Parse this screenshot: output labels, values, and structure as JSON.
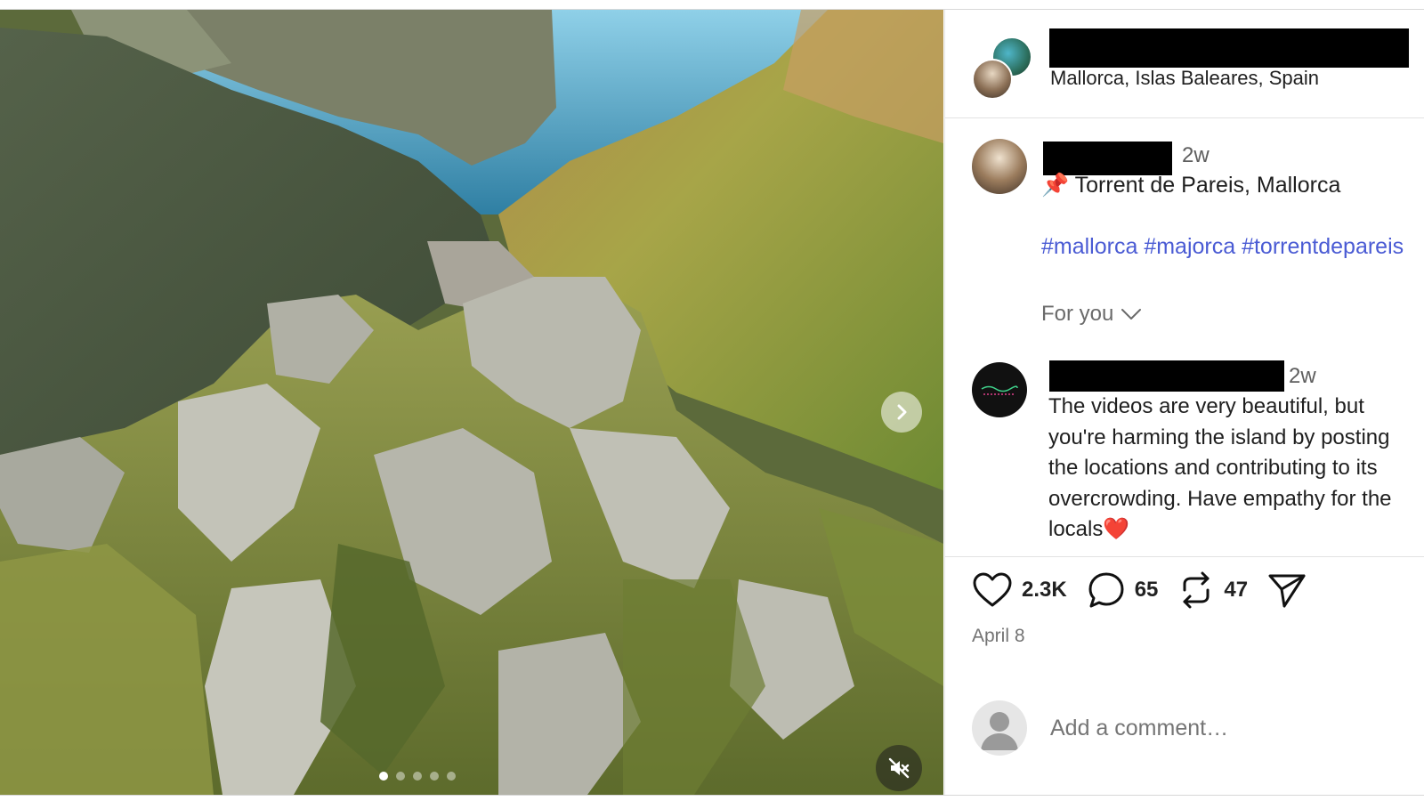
{
  "media": {
    "icons": {
      "next": "chevron-right-icon",
      "mute": "speaker-muted-icon"
    },
    "slides_total": 5,
    "active_slide": 1
  },
  "header": {
    "location": "Mallorca, Islas Baleares, Spain"
  },
  "caption": {
    "time": "2w",
    "pin": "📌",
    "text": "Torrent de Pareis, Mallorca",
    "hashtags": "#mallorca #majorca #torrentdepareis"
  },
  "for_you": {
    "label": "For you"
  },
  "comment": {
    "time": "2w",
    "text": "The videos are very beautiful, but you're harming the island by posting the locations and contributing to its overcrowding. Have empathy for the locals❤️"
  },
  "actions": {
    "likes": "2.3K",
    "comments": "65",
    "reposts": "47"
  },
  "date": "April 8",
  "composer": {
    "placeholder": "Add a comment…"
  },
  "colors": {
    "hashtag": "#4a5bd4",
    "muted_text": "#737373"
  }
}
